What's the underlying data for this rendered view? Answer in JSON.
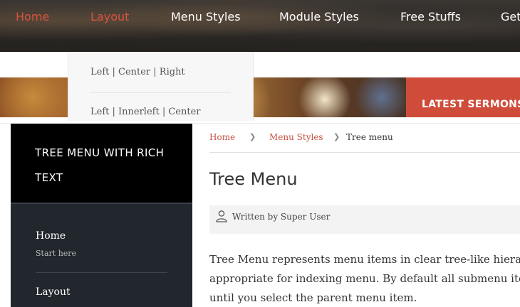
{
  "nav": {
    "items": [
      {
        "label": "Home",
        "active": true
      },
      {
        "label": "Layout",
        "active": true
      },
      {
        "label": "Menu Styles",
        "active": false
      },
      {
        "label": "Module Styles",
        "active": false
      },
      {
        "label": "Free Stuffs",
        "active": false
      },
      {
        "label": "Get",
        "active": false
      }
    ],
    "accent_color": "#d9533f"
  },
  "dropdown": {
    "items": [
      "Left | Center | Right",
      "Left | Innerleft | Center"
    ]
  },
  "banner": {
    "cta": "LATEST SERMONS",
    "cta_color": "#d04c3a"
  },
  "sidebar": {
    "title": "TREE MENU WITH RICH TEXT",
    "items": [
      {
        "label": "Home",
        "sub": "Start here"
      },
      {
        "label": "Layout"
      }
    ]
  },
  "breadcrumb": {
    "items": [
      "Home",
      "Menu Styles",
      "Tree menu"
    ]
  },
  "article": {
    "title": "Tree Menu",
    "author": "Written by Super User",
    "body_lines": [
      "Tree Menu represents menu items in clear tree-like hierarchy,",
      "appropriate for indexing menu. By default all submenu items ar",
      "until you select the parent menu item."
    ]
  }
}
